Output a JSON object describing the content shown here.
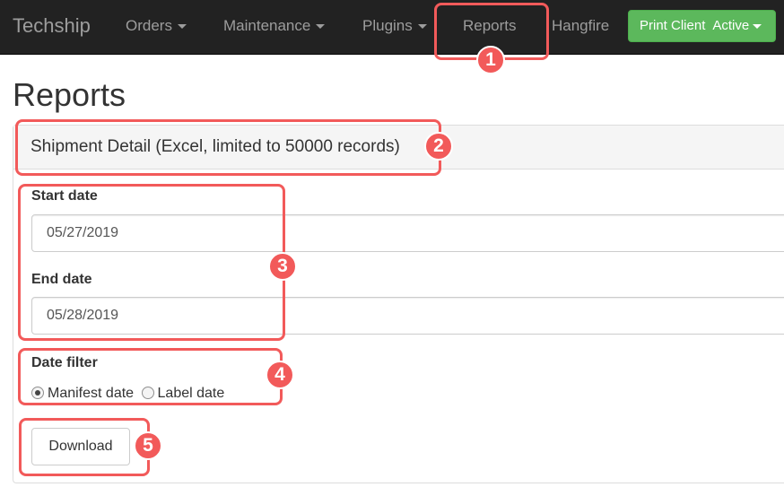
{
  "navbar": {
    "brand": "Techship",
    "items": [
      {
        "label": "Orders",
        "dropdown": true
      },
      {
        "label": "Maintenance",
        "dropdown": true
      },
      {
        "label": "Plugins",
        "dropdown": true
      },
      {
        "label": "Reports",
        "dropdown": false
      },
      {
        "label": "Hangfire",
        "dropdown": false
      }
    ],
    "print_client": {
      "label": "Print Client",
      "status": "Active"
    }
  },
  "page": {
    "title": "Reports"
  },
  "report": {
    "title": "Shipment Detail (Excel, limited to 50000 records)",
    "start_date_label": "Start date",
    "start_date_value": "05/27/2019",
    "end_date_label": "End date",
    "end_date_value": "05/28/2019",
    "date_filter_label": "Date filter",
    "date_filter_options": [
      {
        "label": "Manifest date",
        "selected": true
      },
      {
        "label": "Label date",
        "selected": false
      }
    ],
    "download_label": "Download"
  },
  "annotations": {
    "badges": [
      "1",
      "2",
      "3",
      "4",
      "5"
    ],
    "color": "#f25a5a"
  },
  "colors": {
    "navbar_bg": "#222222",
    "nav_text": "#9d9d9d",
    "success": "#5cb85c",
    "panel_heading_bg": "#f5f5f5"
  }
}
